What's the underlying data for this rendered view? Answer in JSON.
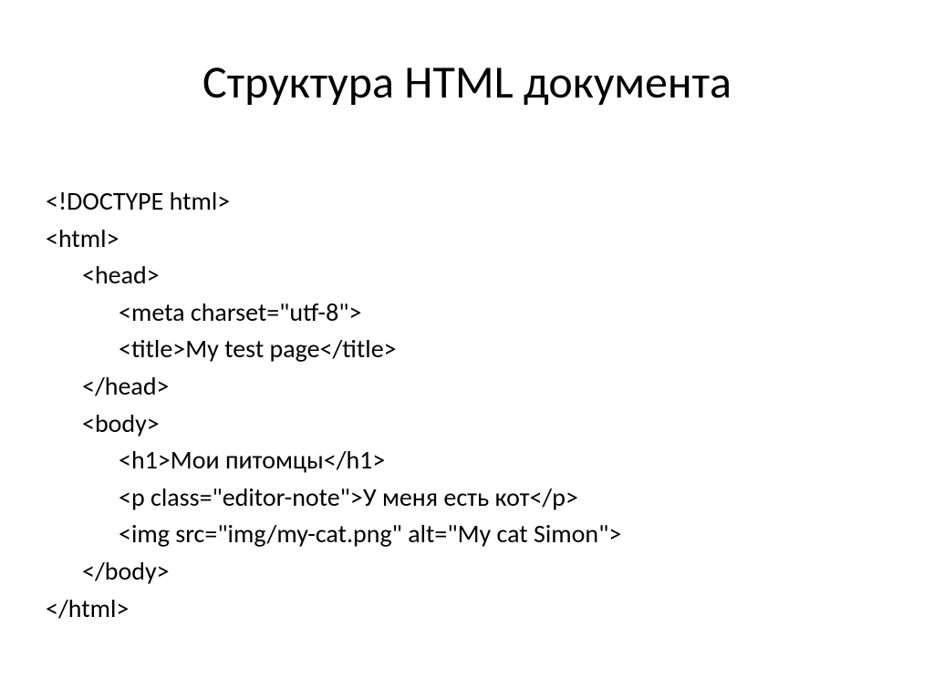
{
  "title": "Структура HTML документа",
  "code": {
    "line1": "<!DOCTYPE html>",
    "line2": "<html>",
    "line3": "<head>",
    "line4": "<meta charset=\"utf-8\">",
    "line5": "<title>My test page</title>",
    "line6": "</head>",
    "line7": "<body>",
    "line8": "<h1>Мои питомцы</h1>",
    "line9": "<p class=\"editor-note\">У меня есть кот</p>",
    "line10": "<img src=\"img/my-cat.png\" alt=\"My cat Simon\">",
    "line11": "</body>",
    "line12": "</html>"
  }
}
